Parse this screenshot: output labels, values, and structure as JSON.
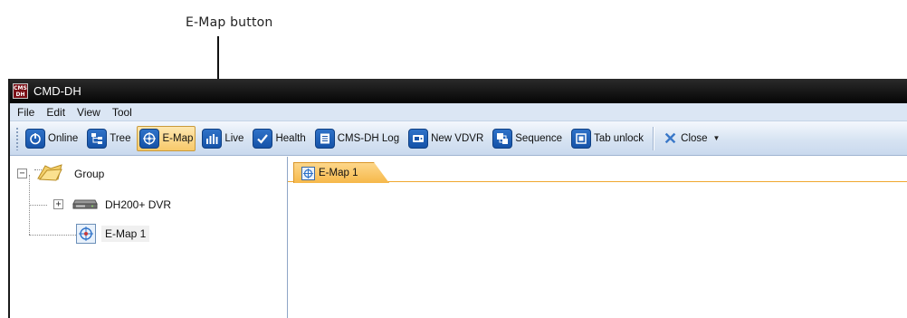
{
  "callout": {
    "label": "E-Map button"
  },
  "window": {
    "logo_text": "CMS DH",
    "title": "CMD-DH"
  },
  "menubar": {
    "items": [
      "File",
      "Edit",
      "View",
      "Tool"
    ]
  },
  "toolbar": {
    "buttons": [
      {
        "label": "Online",
        "icon": "power-icon"
      },
      {
        "label": "Tree",
        "icon": "tree-icon"
      },
      {
        "label": "E-Map",
        "icon": "emap-icon",
        "active": true
      },
      {
        "label": "Live",
        "icon": "live-icon"
      },
      {
        "label": "Health",
        "icon": "health-icon"
      },
      {
        "label": "CMS-DH Log",
        "icon": "log-icon"
      },
      {
        "label": "New VDVR",
        "icon": "vdvr-icon"
      },
      {
        "label": "Sequence",
        "icon": "sequence-icon"
      },
      {
        "label": "Tab unlock",
        "icon": "unlock-icon"
      }
    ],
    "close_label": "Close",
    "close_icon": "close-icon"
  },
  "tree": {
    "root": {
      "label": "Group",
      "expander": "−",
      "icon": "folder-icon"
    },
    "children": [
      {
        "label": "DH200+ DVR",
        "expander": "+",
        "icon": "dvr-icon"
      },
      {
        "label": "E-Map 1",
        "icon": "emap-icon",
        "selected": true
      }
    ]
  },
  "tabs": [
    {
      "label": "E-Map 1",
      "icon": "emap-icon",
      "active": true
    }
  ],
  "colors": {
    "title_bar": "#050505",
    "toolbar_active": "#f8c96a",
    "icon_blue": "#1552a8",
    "tab_orange": "#f6b84a"
  }
}
